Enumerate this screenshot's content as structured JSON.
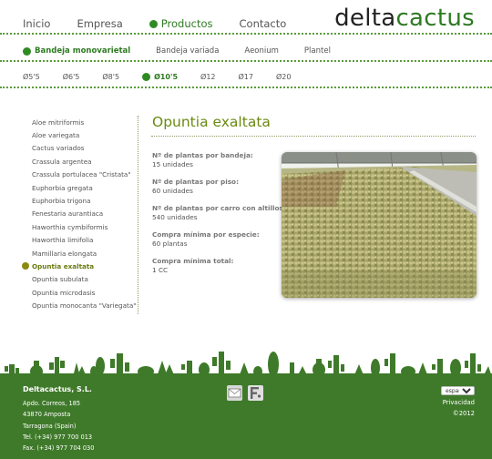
{
  "logo": {
    "part1": "delta",
    "part2": "cactus"
  },
  "main_nav": [
    {
      "label": "Inicio",
      "active": false
    },
    {
      "label": "Empresa",
      "active": false
    },
    {
      "label": "Productos",
      "active": true
    },
    {
      "label": "Contacto",
      "active": false
    }
  ],
  "sub_nav": [
    {
      "label": "Bandeja monovarietal",
      "active": true
    },
    {
      "label": "Bandeja variada",
      "active": false
    },
    {
      "label": "Aeonium",
      "active": false
    },
    {
      "label": "Plantel",
      "active": false
    }
  ],
  "size_nav": [
    {
      "label": "Ø5'5",
      "active": false
    },
    {
      "label": "Ø6'5",
      "active": false
    },
    {
      "label": "Ø8'5",
      "active": false
    },
    {
      "label": "Ø10'5",
      "active": true
    },
    {
      "label": "Ø12",
      "active": false
    },
    {
      "label": "Ø17",
      "active": false
    },
    {
      "label": "Ø20",
      "active": false
    }
  ],
  "sidebar": [
    {
      "label": "Aloe mitriformis",
      "active": false
    },
    {
      "label": "Aloe variegata",
      "active": false
    },
    {
      "label": "Cactus variados",
      "active": false
    },
    {
      "label": "Crassula argentea",
      "active": false
    },
    {
      "label": "Crassula portulacea \"Cristata\"",
      "active": false
    },
    {
      "label": "Euphorbia gregata",
      "active": false
    },
    {
      "label": "Euphorbia trigona",
      "active": false
    },
    {
      "label": "Fenestaria aurantiaca",
      "active": false
    },
    {
      "label": "Haworthia cymbiformis",
      "active": false
    },
    {
      "label": "Haworthia limifolia",
      "active": false
    },
    {
      "label": "Mamillaria elongata",
      "active": false
    },
    {
      "label": "Opuntia exaltata",
      "active": true
    },
    {
      "label": "Opuntia subulata",
      "active": false
    },
    {
      "label": "Opuntia microdasis",
      "active": false
    },
    {
      "label": "Opuntia monocanta \"Variegata\"",
      "active": false
    }
  ],
  "product": {
    "title": "Opuntia exaltata",
    "specs": [
      {
        "key": "Nº de plantas por bandeja:",
        "value": "15 unidades"
      },
      {
        "key": "Nº de plantas por piso:",
        "value": "60 unidades"
      },
      {
        "key": "Nº de plantas por carro con altillos:",
        "value": "540 unidades"
      },
      {
        "key": "Compra mínima por especie:",
        "value": "60 plantas"
      },
      {
        "key": "Compra mínima total:",
        "value": "1 CC"
      }
    ]
  },
  "footer": {
    "company": "Deltacactus, S.L.",
    "address": [
      "Apdo. Correos, 185",
      "43870 Amposta",
      "Tarragona (Spain)",
      "Tel. (+34) 977 700 013",
      "Fax. (+34) 977 704 030"
    ],
    "language_selected": "español",
    "privacy": "Privacidad",
    "copyright": "©2012",
    "social_icons": [
      "mail-icon",
      "flickr-icon"
    ]
  },
  "colors": {
    "brand_green": "#2e7a22",
    "footer_green": "#3f7a2a",
    "active_olive": "#6a7a10"
  }
}
